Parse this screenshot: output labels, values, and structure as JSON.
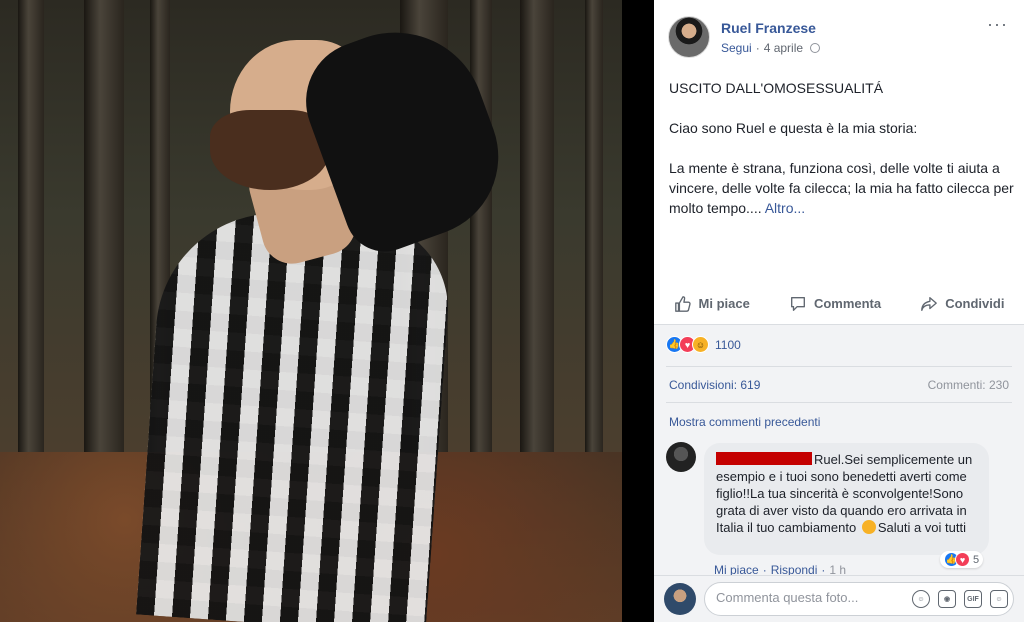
{
  "post": {
    "author": "Ruel Franzese",
    "follow": "Segui",
    "sep": "·",
    "date": "4 aprile",
    "more_menu": "···",
    "title": "USCITO DALL'OMOSESSUALITÁ",
    "intro": "Ciao sono Ruel e questa è la mia storia:",
    "body": "La mente è strana, funziona così, delle volte ti aiuta a vincere, delle volte fa cilecca; la mia ha fatto cilecca per molto tempo....",
    "more_link": "Altro..."
  },
  "actions": {
    "like": "Mi piace",
    "comment": "Commenta",
    "share": "Condividi"
  },
  "reactions": {
    "count": "1100",
    "icons": [
      "like-reaction",
      "love-reaction",
      "haha-reaction"
    ]
  },
  "stats": {
    "shares": "Condivisioni: 619",
    "comments": "Commenti: 230"
  },
  "comments": {
    "show_previous": "Mostra commenti precedenti",
    "items": [
      {
        "text_before_emoji": "Ruel.Sei semplicemente un esempio e i tuoi sono benedetti averti come figlio!!La tua sincerità è sconvolgente!Sono grata di aver visto da quando ero arrivata in Italia il tuo cambiamento",
        "text_after_emoji": "Saluti a voi tutti",
        "reaction_count": "5",
        "like": "Mi piace",
        "reply": "Rispondi",
        "time": "1 h",
        "sep": "·"
      }
    ]
  },
  "composer": {
    "placeholder": "Commenta questa foto...",
    "tools": [
      "emoji-icon",
      "camera-icon",
      "gif-icon",
      "sticker-icon"
    ],
    "gif_label": "GIF"
  },
  "colors": {
    "link": "#385898",
    "like": "#1877f2",
    "love": "#f33e58",
    "haha": "#f7b125"
  }
}
